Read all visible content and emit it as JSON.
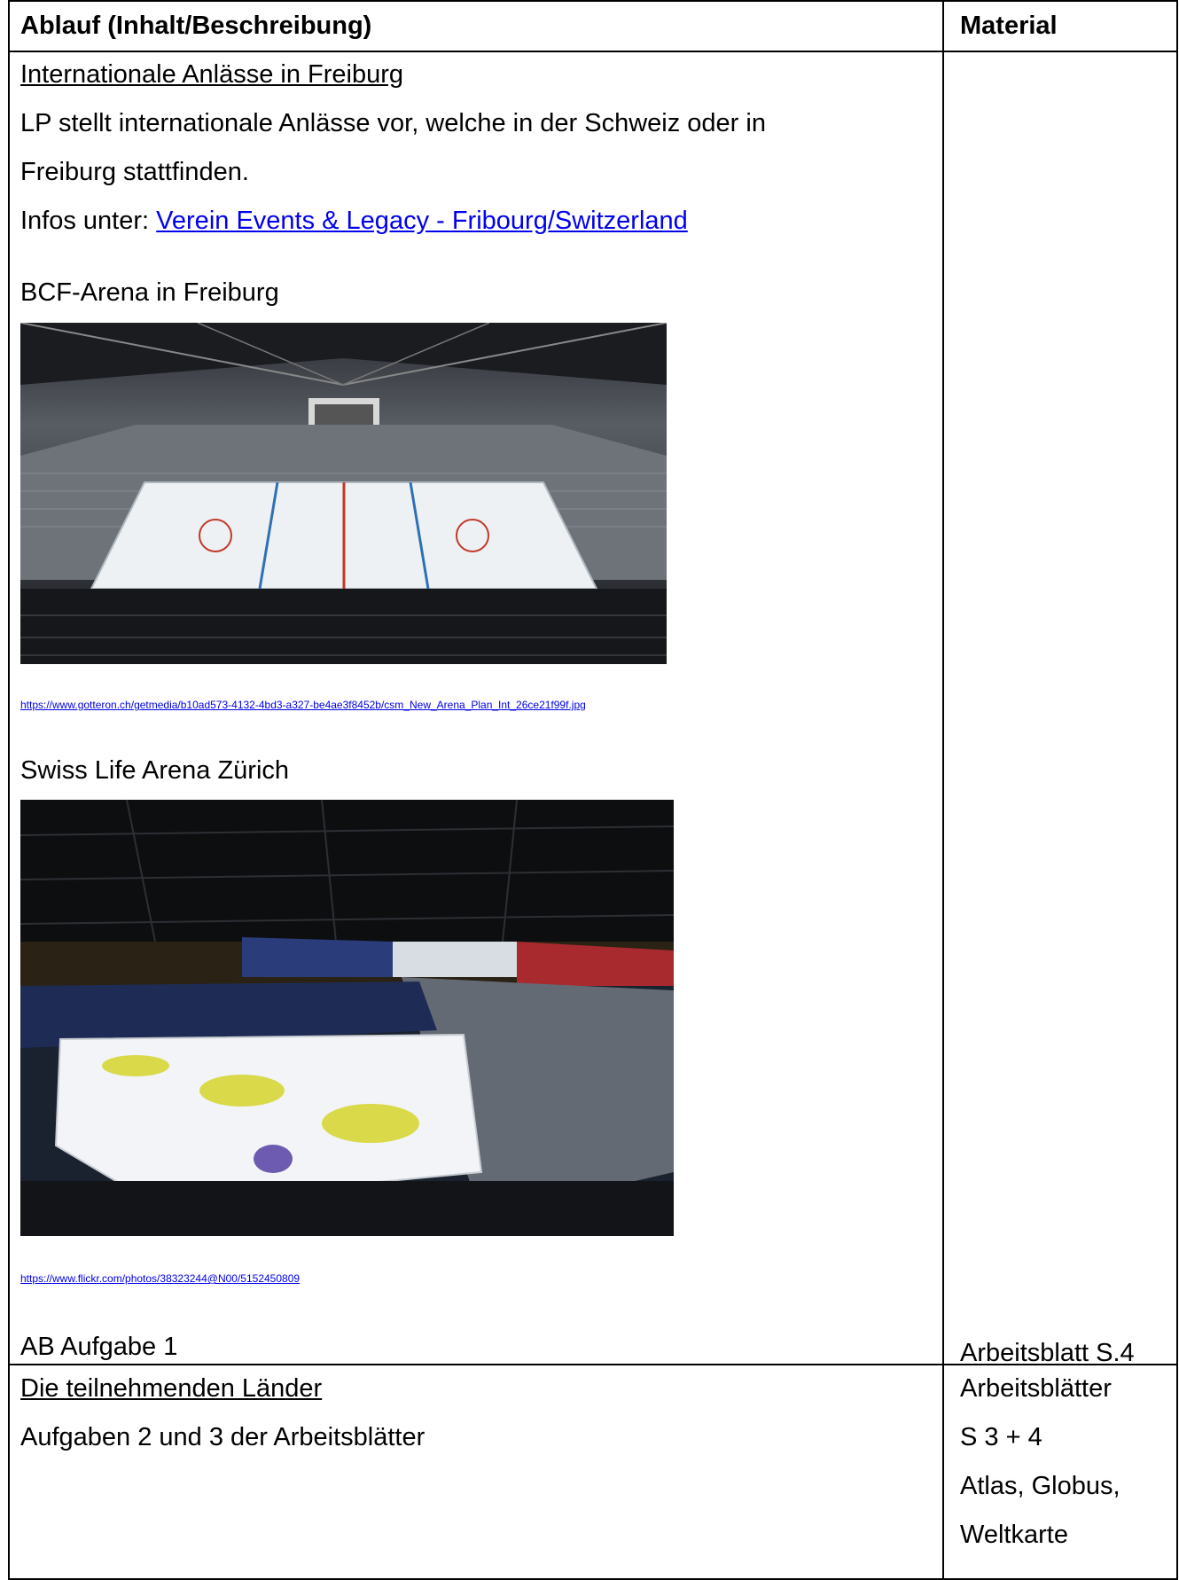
{
  "table": {
    "col_headers": {
      "procedure": "Ablauf (Inhalt/Beschreibung)",
      "material": "Material"
    },
    "row1": {
      "heading": "Internationale Anlässe in Freiburg",
      "intro_line1": "LP stellt internationale Anlässe vor, welche in der Schweiz oder in",
      "intro_line2": "Freiburg stattfinden.",
      "info_prefix": "Infos unter: ",
      "info_link": "Verein Events & Legacy - Fribourg/Switzerland",
      "arena1_title": "BCF-Arena in Freiburg",
      "arena1_url": "https://www.gotteron.ch/getmedia/b10ad573-4132-4bd3-a327-be4ae3f8452b/csm_New_Arena_Plan_Int_26ce21f99f.jpg",
      "arena2_title": "Swiss Life Arena Zürich",
      "arena2_url": "https://www.flickr.com/photos/38323244@N00/5152450809",
      "task": "AB Aufgabe 1",
      "material": "Arbeitsblatt S.4"
    },
    "row2": {
      "heading": "Die teilnehmenden Länder",
      "task": "Aufgaben 2 und 3 der Arbeitsblätter",
      "material_lines": [
        "Arbeitsblätter",
        "S 3 + 4",
        "Atlas, Globus,",
        "Weltkarte"
      ]
    }
  }
}
